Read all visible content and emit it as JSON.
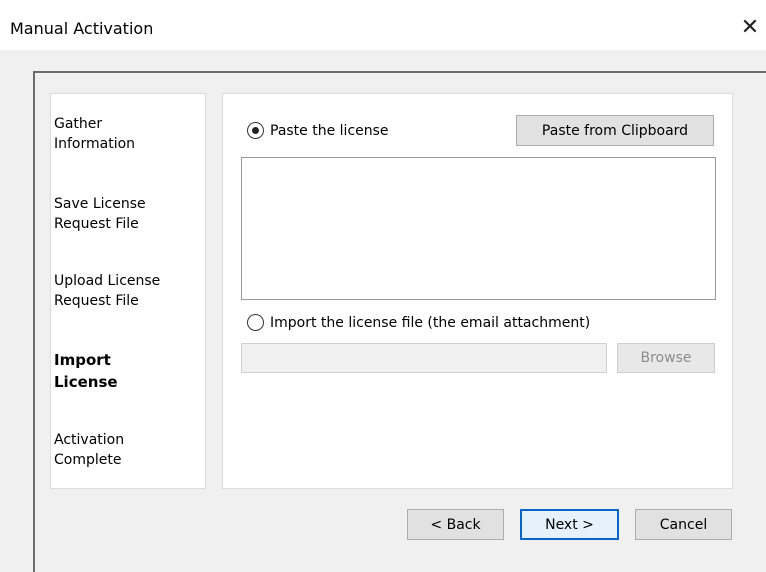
{
  "window": {
    "title": "Manual Activation",
    "close_glyph": "✕"
  },
  "steps": [
    {
      "label": "Gather\nInformation",
      "active": false
    },
    {
      "label": "Save License\nRequest File",
      "active": false
    },
    {
      "label": "Upload License\nRequest File",
      "active": false
    },
    {
      "label": "Import\nLicense",
      "active": true
    },
    {
      "label": "Activation\nComplete",
      "active": false
    }
  ],
  "content": {
    "paste_option_label": "Paste the license",
    "paste_option_selected": true,
    "paste_from_clipboard_label": "Paste from Clipboard",
    "license_text_value": "",
    "import_option_label": "Import the license file (the email attachment)",
    "import_option_selected": false,
    "file_path_value": "",
    "browse_label": "Browse"
  },
  "footer": {
    "back_label": "< Back",
    "next_label": "Next >",
    "cancel_label": "Cancel"
  }
}
